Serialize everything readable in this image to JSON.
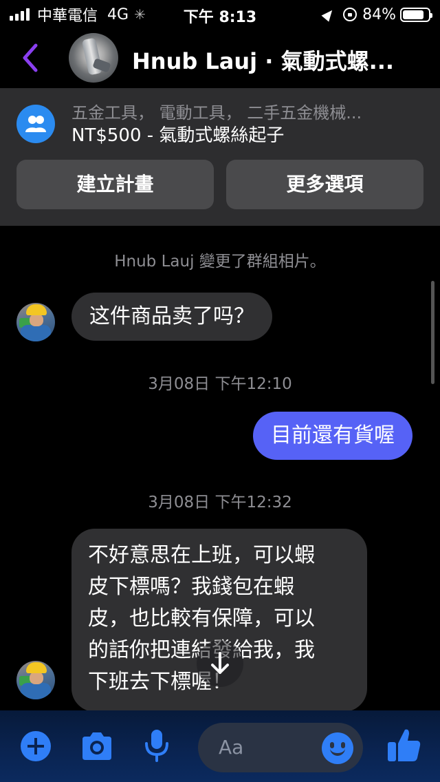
{
  "status_bar": {
    "carrier": "中華電信",
    "network": "4G",
    "time": "下午 8:13",
    "battery": "84%",
    "battery_level": 0.84
  },
  "header": {
    "title": "Hnub Lauj · 氣動式螺..."
  },
  "listing": {
    "category": "五金工具， 電動工具， 二手五金機械...",
    "price_title": "NT$500 - 氣動式螺絲起子",
    "create_plan_label": "建立計畫",
    "more_options_label": "更多選項"
  },
  "conversation": {
    "system_note": "Hnub Lauj 變更了群組相片。",
    "messages": [
      {
        "direction": "incoming",
        "text": "这件商品卖了吗？"
      },
      {
        "type": "timestamp",
        "text": "3月08日 下午12:10"
      },
      {
        "direction": "outgoing",
        "text": "目前還有貨喔"
      },
      {
        "type": "timestamp",
        "text": "3月08日 下午12:32"
      },
      {
        "direction": "incoming",
        "lines": [
          "不好意思在上班，可以蝦",
          "皮下標嗎？我錢包在蝦",
          "皮，也比較有保障，可以",
          "的話你把連結發給我，我",
          "下班去下標喔！"
        ]
      }
    ]
  },
  "composer": {
    "placeholder": "Aa"
  },
  "colors": {
    "accent": "#5662f6",
    "back_arrow": "#8a3ff0",
    "messenger_blue": "#2f7ef7"
  }
}
